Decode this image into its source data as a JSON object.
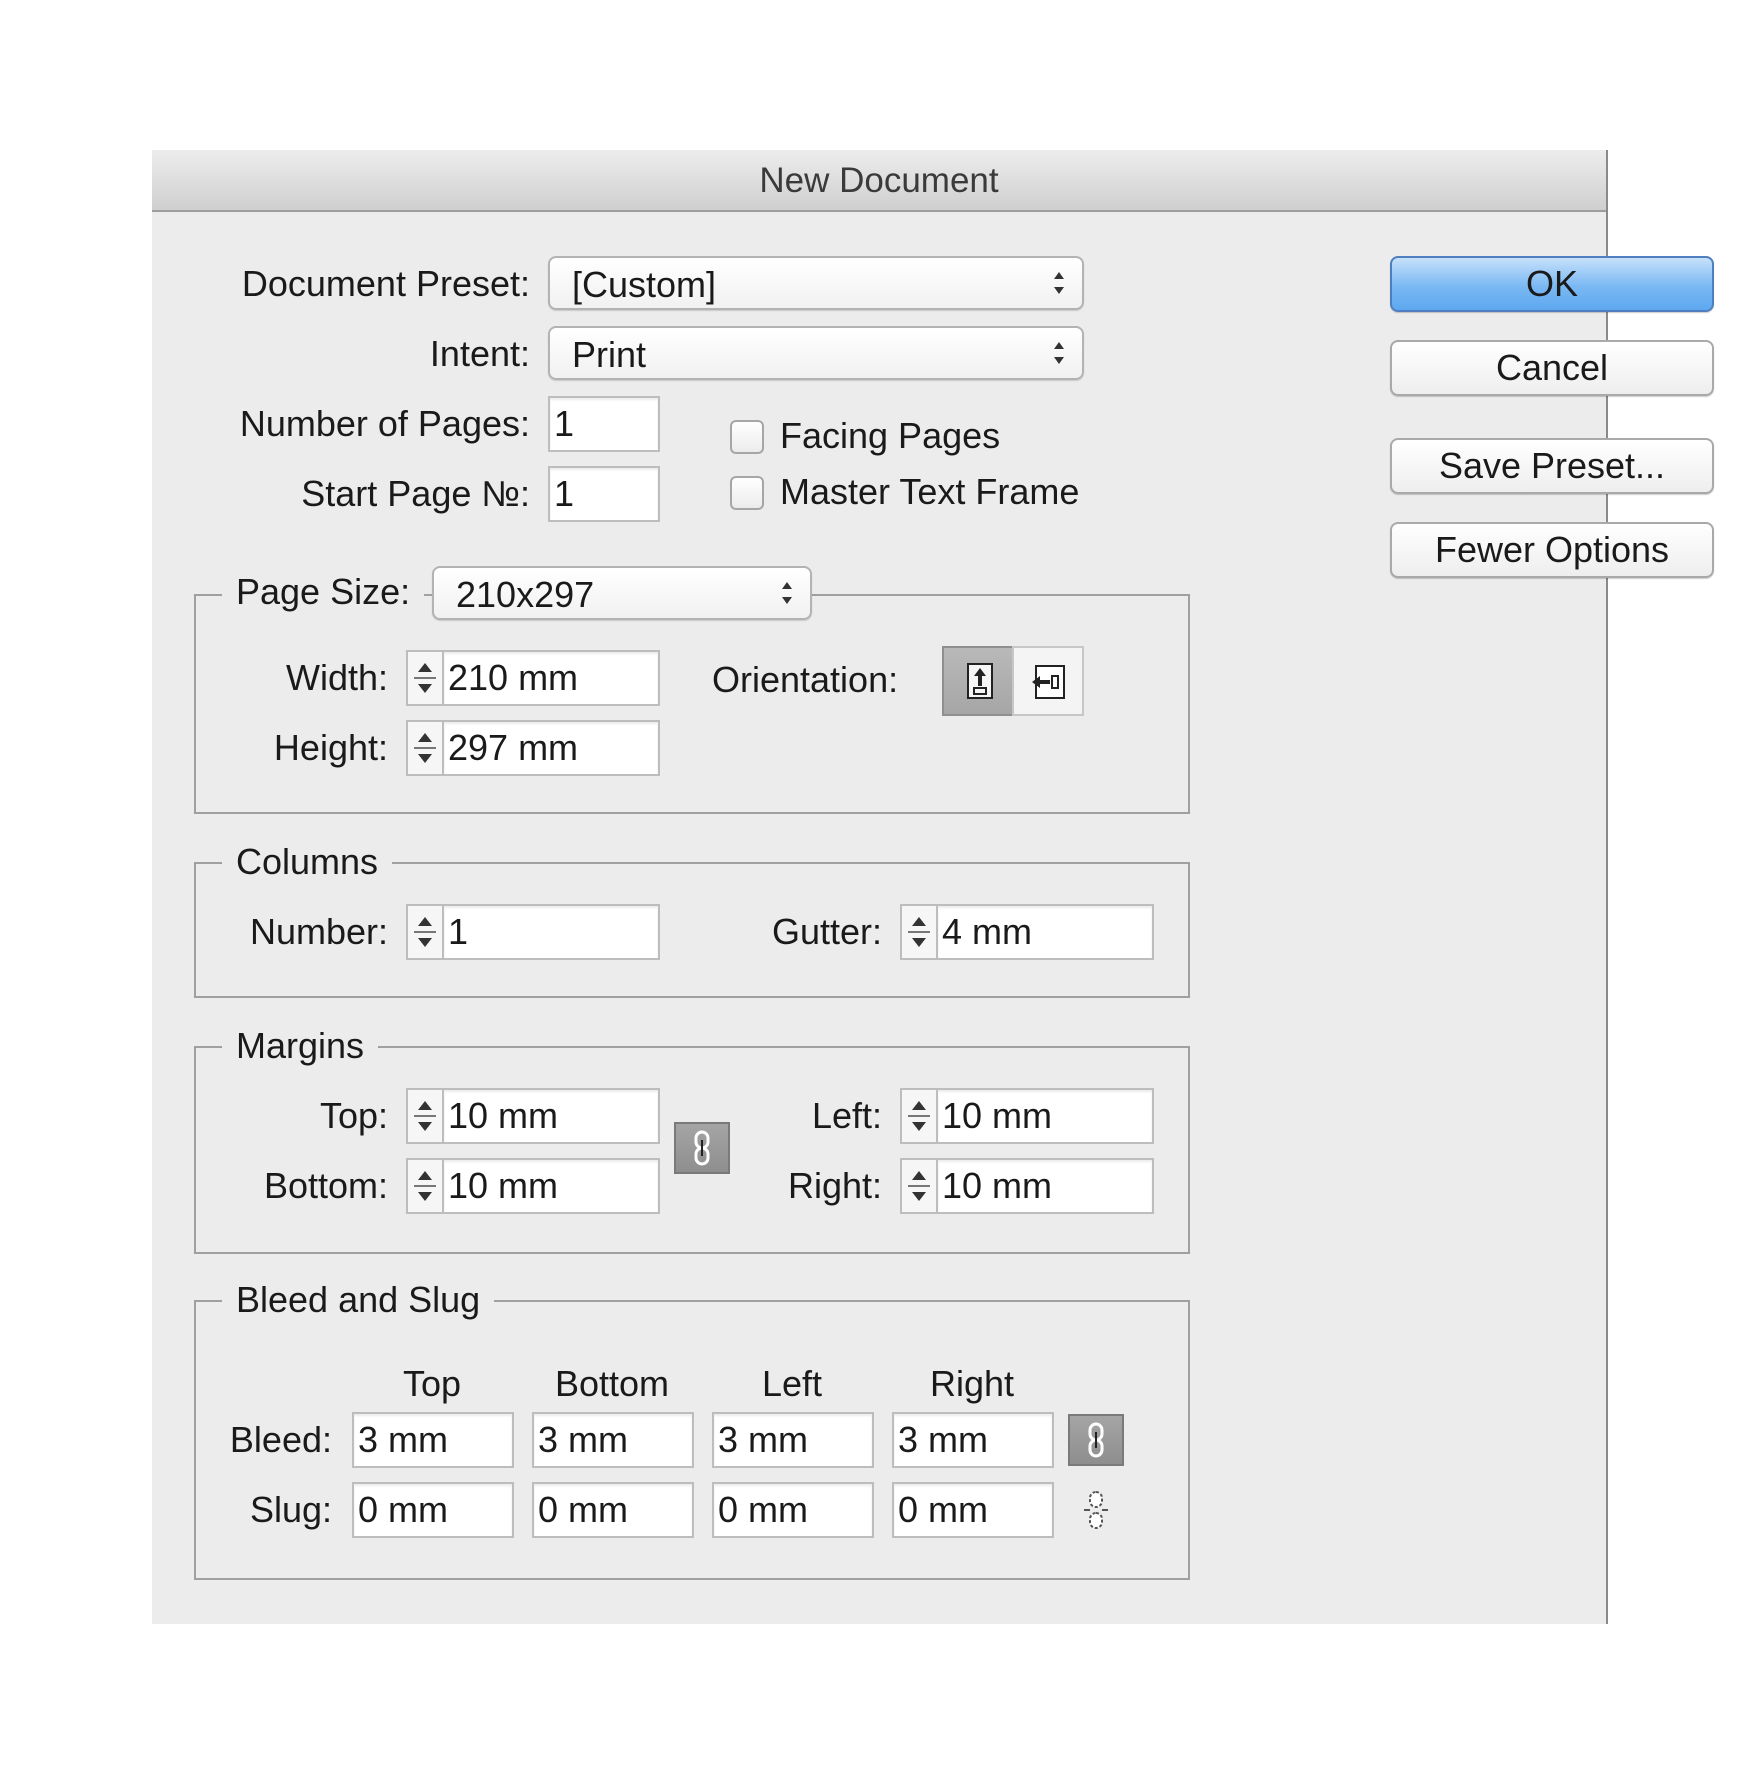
{
  "window": {
    "title": "New Document"
  },
  "preset": {
    "label": "Document Preset:",
    "value": "[Custom]"
  },
  "intent": {
    "label": "Intent:",
    "value": "Print"
  },
  "pages": {
    "number_label": "Number of Pages:",
    "number_value": "1",
    "start_label": "Start Page №:",
    "start_value": "1",
    "facing_label": "Facing Pages",
    "facing_checked": false,
    "master_label": "Master Text Frame",
    "master_checked": false
  },
  "buttons": {
    "ok": "OK",
    "cancel": "Cancel",
    "save_preset": "Save Preset...",
    "fewer_options": "Fewer Options"
  },
  "page_size": {
    "label": "Page Size:",
    "value": "210x297",
    "width_label": "Width:",
    "width_value": "210 mm",
    "height_label": "Height:",
    "height_value": "297 mm",
    "orientation_label": "Orientation:",
    "orientation_selected": "portrait",
    "portrait_icon": "portrait-orientation-icon",
    "landscape_icon": "landscape-orientation-icon"
  },
  "columns": {
    "title": "Columns",
    "number_label": "Number:",
    "number_value": "1",
    "gutter_label": "Gutter:",
    "gutter_value": "4 mm"
  },
  "margins": {
    "title": "Margins",
    "top_label": "Top:",
    "top_value": "10 mm",
    "bottom_label": "Bottom:",
    "bottom_value": "10 mm",
    "left_label": "Left:",
    "left_value": "10 mm",
    "right_label": "Right:",
    "right_value": "10 mm",
    "link_icon": "chain-link-icon"
  },
  "bleed_slug": {
    "title": "Bleed and Slug",
    "headers": [
      "Top",
      "Bottom",
      "Left",
      "Right"
    ],
    "bleed_label": "Bleed:",
    "bleed_values": [
      "3 mm",
      "3 mm",
      "3 mm",
      "3 mm"
    ],
    "slug_label": "Slug:",
    "slug_values": [
      "0 mm",
      "0 mm",
      "0 mm",
      "0 mm"
    ],
    "bleed_link_icon": "chain-link-icon",
    "slug_link_icon": "broken-chain-icon"
  }
}
